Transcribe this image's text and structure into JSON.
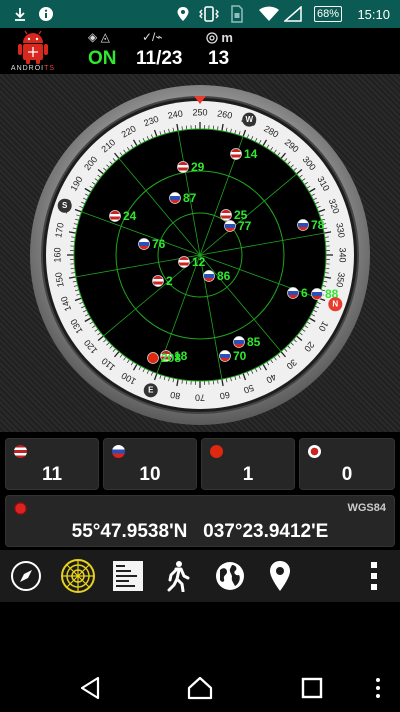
{
  "status_bar": {
    "time": "15:10",
    "battery": "68%",
    "icons": [
      "download-icon",
      "info-icon",
      "location-icon",
      "vibrate-icon",
      "sim-icon",
      "wifi-icon",
      "signal-icon",
      "battery-icon"
    ]
  },
  "header": {
    "logo_text_left": "ANDROI",
    "logo_text_right": "TS",
    "fix_label_icons": "◈ ◬",
    "fix_value": "ON",
    "sats_label_icons": "✓/⌁",
    "sats_value": "11/23",
    "accuracy_label": "m",
    "accuracy_value": "13"
  },
  "compass": {
    "heading_marker_color": "#e83a2e",
    "cardinal_marks": [
      "N",
      "E",
      "S",
      "W"
    ],
    "tick_labels": [
      "250",
      "260",
      "270",
      "280",
      "290",
      "300",
      "310",
      "320",
      "330",
      "340",
      "350",
      "0",
      "10",
      "20",
      "30",
      "40",
      "50",
      "60",
      "70",
      "80",
      "90",
      "100",
      "110",
      "120",
      "130",
      "140",
      "150",
      "160",
      "170",
      "180",
      "190",
      "200",
      "210",
      "220",
      "230",
      "240"
    ],
    "satellites": [
      {
        "id": "29",
        "flag": "us"
      },
      {
        "id": "14",
        "flag": "us"
      },
      {
        "id": "87",
        "flag": "ru"
      },
      {
        "id": "24",
        "flag": "us"
      },
      {
        "id": "25",
        "flag": "us"
      },
      {
        "id": "77",
        "flag": "ru"
      },
      {
        "id": "78",
        "flag": "ru"
      },
      {
        "id": "76",
        "flag": "ru"
      },
      {
        "id": "12",
        "flag": "us"
      },
      {
        "id": "86",
        "flag": "ru"
      },
      {
        "id": "2",
        "flag": "us"
      },
      {
        "id": "6",
        "flag": "ru"
      },
      {
        "id": "88",
        "flag": "ru"
      },
      {
        "id": "18",
        "flag": "us"
      },
      {
        "id": "208",
        "flag": "cn"
      },
      {
        "id": "85",
        "flag": "ru"
      },
      {
        "id": "70",
        "flag": "ru"
      }
    ]
  },
  "stats": {
    "gps": "11",
    "glonass": "10",
    "beidou": "1",
    "qzss": "0"
  },
  "coordinates": {
    "datum": "WGS84",
    "value": "55°47.9538'N   037°23.9412'E"
  },
  "colors": {
    "green": "#2fe82f",
    "statusbar": "#0b5a53",
    "radar_line": "#1fa51f"
  },
  "toolbar": {
    "items": [
      "compass-icon",
      "radar-icon",
      "list-icon",
      "walk-icon",
      "globe-icon",
      "map-pin-icon",
      "more-vert-icon"
    ]
  },
  "navbar": {
    "items": [
      "back-icon",
      "home-icon",
      "recents-icon",
      "menu-dots-icon"
    ]
  }
}
